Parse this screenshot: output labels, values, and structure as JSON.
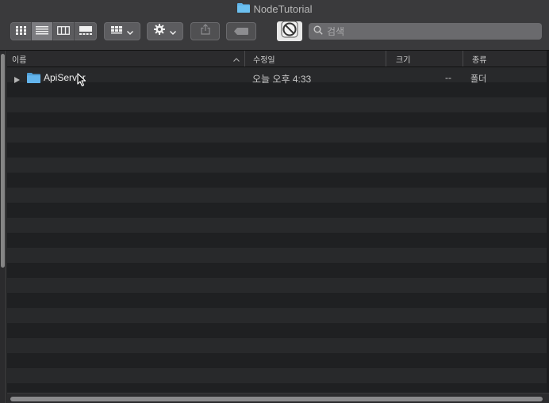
{
  "window": {
    "title": "NodeTutorial",
    "title_icon": "folder-icon"
  },
  "toolbar": {
    "view_buttons": [
      {
        "name": "icon-view",
        "icon": "grid-icon"
      },
      {
        "name": "list-view",
        "icon": "list-icon",
        "active": true
      },
      {
        "name": "column-view",
        "icon": "columns-icon"
      },
      {
        "name": "gallery-view",
        "icon": "gallery-icon"
      }
    ],
    "arrange_icon": "grid-arrange-icon",
    "action_icon": "gear-icon",
    "share_icon": "share-icon",
    "tag_icon": "tag-icon",
    "app_icon": "no-entry-icon"
  },
  "search": {
    "placeholder": "검색",
    "value": ""
  },
  "columns": {
    "name": "이름",
    "date": "수정일",
    "size": "크기",
    "kind": "종류"
  },
  "rows": [
    {
      "name": "ApiServer",
      "date": "오늘 오후 4:33",
      "size": "--",
      "kind": "폴더",
      "icon": "folder-icon",
      "expanded": false
    }
  ],
  "colors": {
    "folder": "#5fb3e8",
    "row_light": "#28292b",
    "row_dark": "#1f2022",
    "toolbar": "#3a3a3c"
  }
}
